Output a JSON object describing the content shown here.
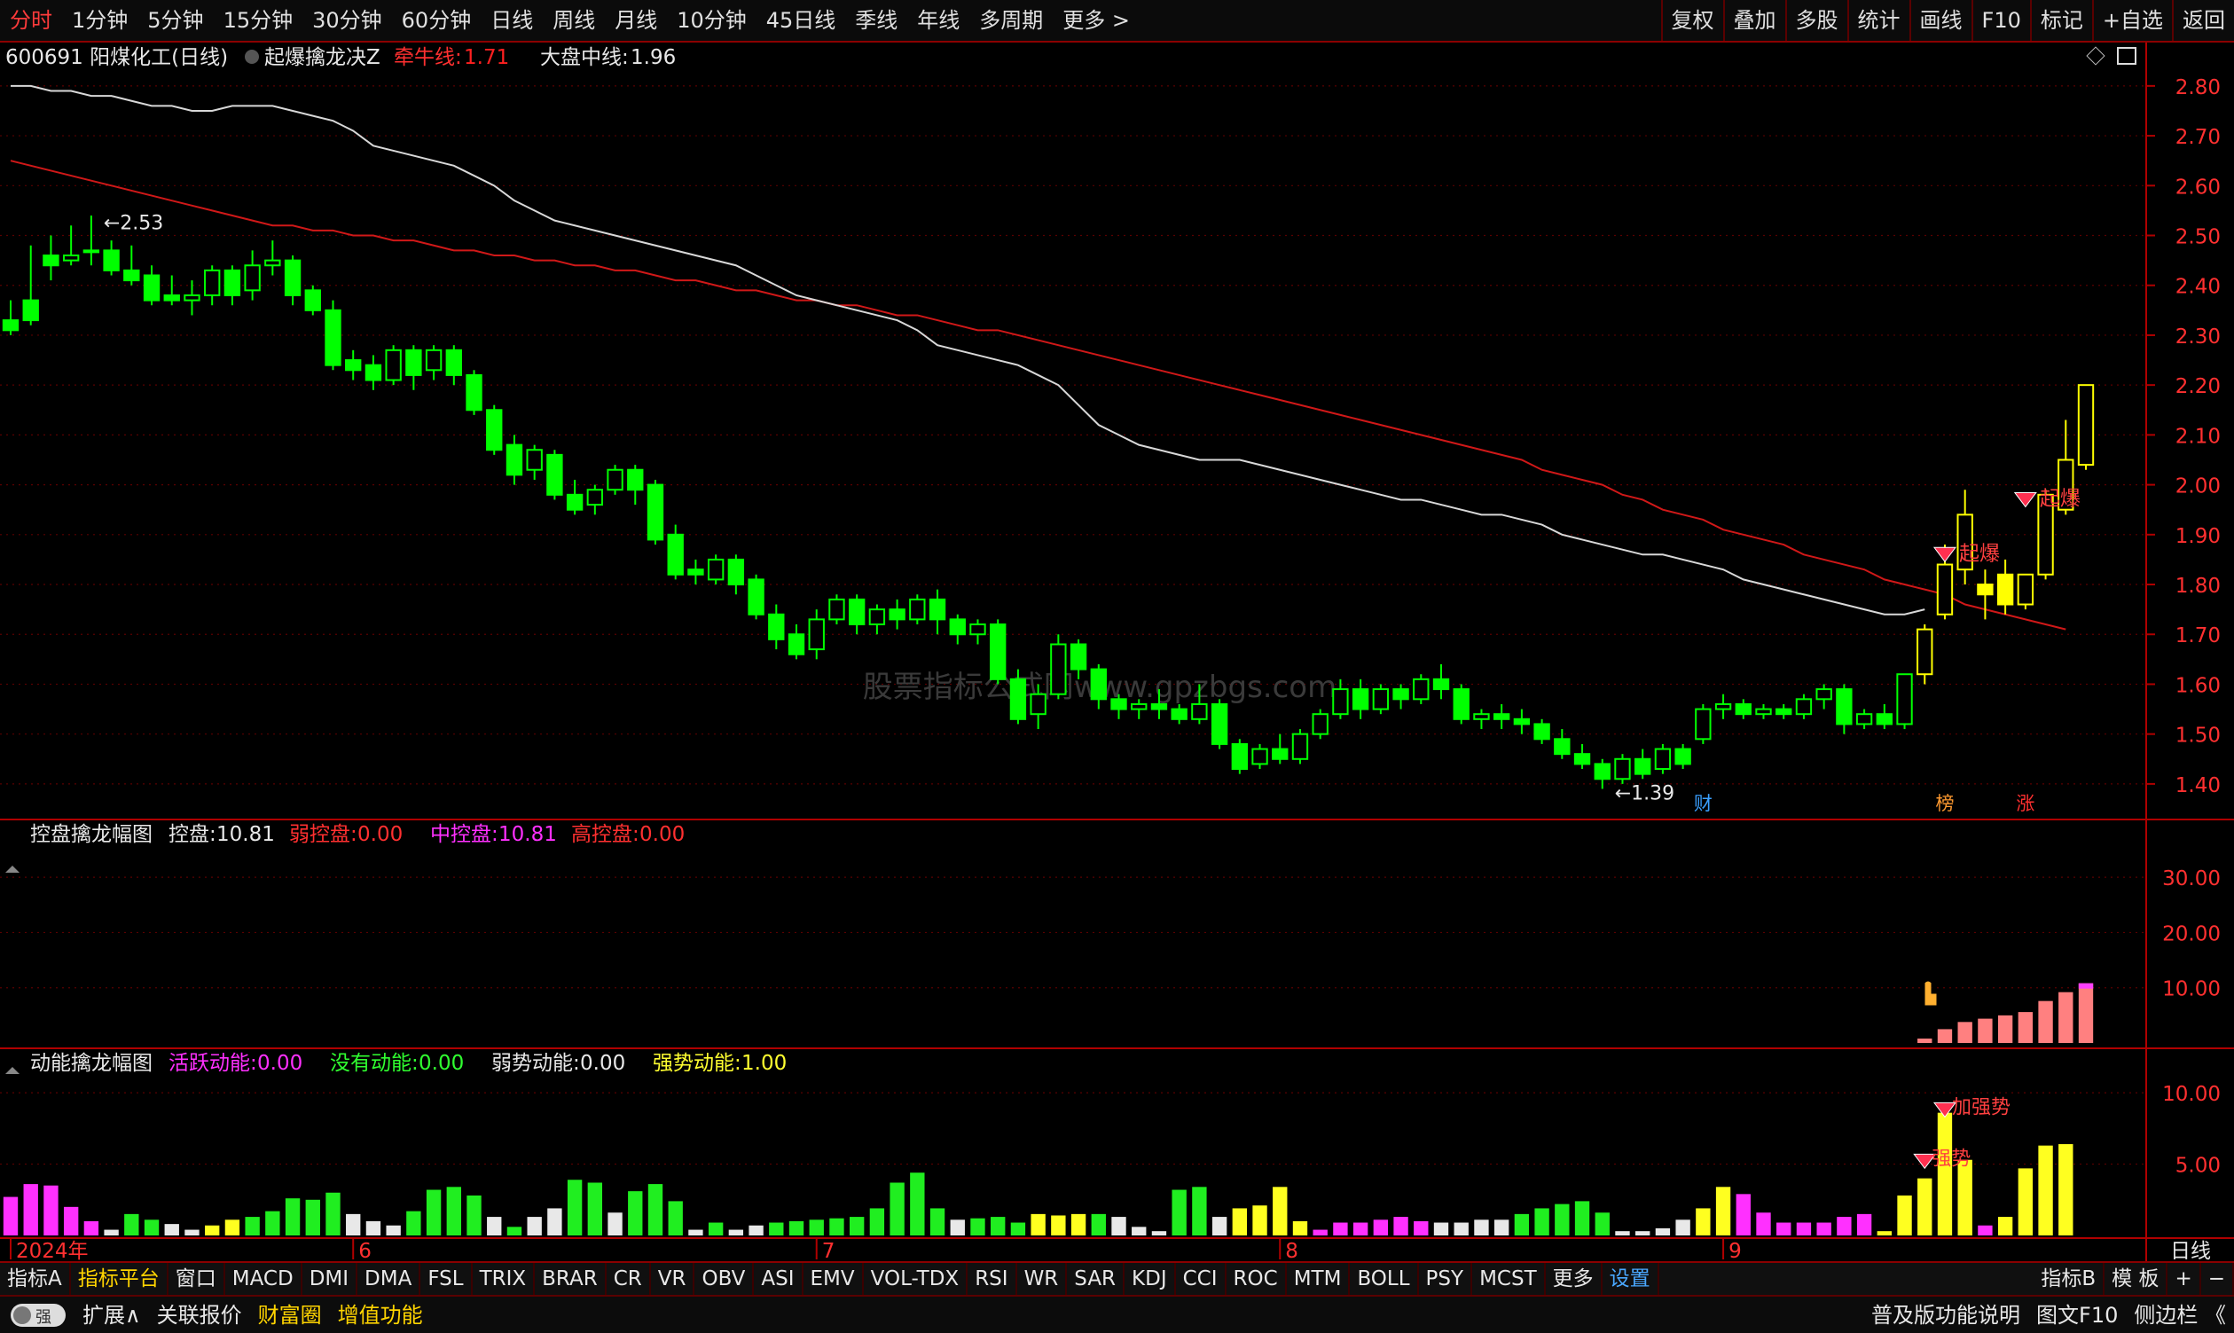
{
  "periods": [
    "分时",
    "1分钟",
    "5分钟",
    "15分钟",
    "30分钟",
    "60分钟",
    "日线",
    "周线",
    "月线",
    "10分钟",
    "45日线",
    "季线",
    "年线",
    "多周期",
    "更多 >"
  ],
  "active_period": "分时",
  "toolbar_right": [
    "复权",
    "叠加",
    "多股",
    "统计",
    "画线",
    "F10",
    "标记",
    "+自选",
    "返回"
  ],
  "indicator_tabs": [
    "指标A",
    "指标平台",
    "窗口",
    "MACD",
    "DMI",
    "DMA",
    "FSL",
    "TRIX",
    "BRAR",
    "CR",
    "VR",
    "OBV",
    "ASI",
    "EMV",
    "VOL-TDX",
    "RSI",
    "WR",
    "SAR",
    "KDJ",
    "CCI",
    "ROC",
    "MTM",
    "BOLL",
    "PSY",
    "MCST",
    "更多",
    "设置"
  ],
  "indicator_right": [
    "指标B",
    "模 板",
    "+",
    "−"
  ],
  "bottom_left": [
    "扩展∧",
    "关联报价",
    "财富圈",
    "增值功能"
  ],
  "bottom_right": [
    "普及版功能说明",
    "图文F10",
    "侧边栏 《"
  ],
  "toggle_label": "强",
  "period_label": "日线",
  "watermark": "股票指标公式网www.gpzbgs.com",
  "colors": {
    "up": "#00ff00",
    "down": "#00ff00",
    "yellow": "#ffff00",
    "red": "#ff2020",
    "white": "#e8e8e8",
    "magenta": "#ff00ff"
  },
  "chart_data": [
    {
      "type": "candlestick",
      "title": "600691 阳煤化工(日线)",
      "indicator": "起爆擒龙决Z",
      "legend": [
        {
          "name": "牵牛线",
          "value": "1.71",
          "color": "#ff2020"
        },
        {
          "name": "大盘中线",
          "value": "1.96",
          "color": "#e8e8e8"
        }
      ],
      "ylim": [
        1.35,
        2.83
      ],
      "yticks": [
        "2.80",
        "2.70",
        "2.60",
        "2.50",
        "2.40",
        "2.30",
        "2.20",
        "2.10",
        "2.00",
        "1.90",
        "1.80",
        "1.70",
        "1.60",
        "1.50",
        "1.40"
      ],
      "high_label": "←2.53",
      "low_label": "←1.39",
      "x_month_labels": [
        {
          "label": "2024年",
          "i": 0
        },
        {
          "label": "6",
          "i": 17
        },
        {
          "label": "7",
          "i": 40
        },
        {
          "label": "8",
          "i": 63
        },
        {
          "label": "9",
          "i": 85
        }
      ],
      "event_markers": [
        {
          "label": "财",
          "i": 84,
          "color": "#3aa0ff"
        },
        {
          "label": "榜",
          "i": 96,
          "color": "#ff9a30"
        },
        {
          "label": "涨",
          "i": 100,
          "color": "#ff3030"
        }
      ],
      "signals": [
        {
          "label": "起爆",
          "i": 96,
          "price": 1.86
        },
        {
          "label": "起爆",
          "i": 100,
          "price": 1.97
        }
      ],
      "candles": [
        [
          2.33,
          2.37,
          2.31,
          2.3
        ],
        [
          2.37,
          2.48,
          2.33,
          2.32
        ],
        [
          2.46,
          2.5,
          2.44,
          2.41
        ],
        [
          2.45,
          2.52,
          2.46,
          2.44
        ],
        [
          2.47,
          2.54,
          2.47,
          2.44
        ],
        [
          2.47,
          2.49,
          2.43,
          2.42
        ],
        [
          2.43,
          2.48,
          2.41,
          2.4
        ],
        [
          2.42,
          2.44,
          2.37,
          2.36
        ],
        [
          2.38,
          2.42,
          2.37,
          2.36
        ],
        [
          2.37,
          2.41,
          2.38,
          2.34
        ],
        [
          2.38,
          2.44,
          2.43,
          2.36
        ],
        [
          2.43,
          2.44,
          2.38,
          2.36
        ],
        [
          2.39,
          2.47,
          2.44,
          2.37
        ],
        [
          2.44,
          2.49,
          2.45,
          2.42
        ],
        [
          2.45,
          2.46,
          2.38,
          2.36
        ],
        [
          2.39,
          2.4,
          2.35,
          2.34
        ],
        [
          2.35,
          2.37,
          2.24,
          2.23
        ],
        [
          2.25,
          2.27,
          2.23,
          2.21
        ],
        [
          2.24,
          2.26,
          2.21,
          2.19
        ],
        [
          2.21,
          2.28,
          2.27,
          2.2
        ],
        [
          2.27,
          2.28,
          2.22,
          2.19
        ],
        [
          2.23,
          2.28,
          2.27,
          2.21
        ],
        [
          2.27,
          2.28,
          2.22,
          2.2
        ],
        [
          2.22,
          2.23,
          2.15,
          2.14
        ],
        [
          2.15,
          2.16,
          2.07,
          2.06
        ],
        [
          2.08,
          2.1,
          2.02,
          2.0
        ],
        [
          2.03,
          2.08,
          2.07,
          2.01
        ],
        [
          2.06,
          2.07,
          1.98,
          1.97
        ],
        [
          1.98,
          2.01,
          1.95,
          1.94
        ],
        [
          1.96,
          2.0,
          1.99,
          1.94
        ],
        [
          1.99,
          2.04,
          2.03,
          1.98
        ],
        [
          2.03,
          2.04,
          1.99,
          1.96
        ],
        [
          2.0,
          2.01,
          1.89,
          1.88
        ],
        [
          1.9,
          1.92,
          1.82,
          1.81
        ],
        [
          1.83,
          1.85,
          1.82,
          1.8
        ],
        [
          1.81,
          1.86,
          1.85,
          1.8
        ],
        [
          1.85,
          1.86,
          1.8,
          1.78
        ],
        [
          1.81,
          1.82,
          1.74,
          1.73
        ],
        [
          1.74,
          1.76,
          1.69,
          1.67
        ],
        [
          1.7,
          1.72,
          1.66,
          1.65
        ],
        [
          1.67,
          1.75,
          1.73,
          1.65
        ],
        [
          1.73,
          1.78,
          1.77,
          1.72
        ],
        [
          1.77,
          1.78,
          1.72,
          1.7
        ],
        [
          1.72,
          1.76,
          1.75,
          1.7
        ],
        [
          1.75,
          1.77,
          1.73,
          1.71
        ],
        [
          1.73,
          1.78,
          1.77,
          1.72
        ],
        [
          1.77,
          1.79,
          1.73,
          1.7
        ],
        [
          1.73,
          1.74,
          1.7,
          1.68
        ],
        [
          1.7,
          1.73,
          1.72,
          1.68
        ],
        [
          1.72,
          1.73,
          1.61,
          1.6
        ],
        [
          1.61,
          1.63,
          1.53,
          1.52
        ],
        [
          1.54,
          1.6,
          1.58,
          1.51
        ],
        [
          1.58,
          1.7,
          1.68,
          1.57
        ],
        [
          1.68,
          1.69,
          1.63,
          1.61
        ],
        [
          1.63,
          1.64,
          1.57,
          1.55
        ],
        [
          1.57,
          1.58,
          1.55,
          1.53
        ],
        [
          1.55,
          1.57,
          1.56,
          1.53
        ],
        [
          1.56,
          1.59,
          1.55,
          1.53
        ],
        [
          1.55,
          1.56,
          1.53,
          1.52
        ],
        [
          1.53,
          1.6,
          1.56,
          1.52
        ],
        [
          1.56,
          1.57,
          1.48,
          1.47
        ],
        [
          1.48,
          1.49,
          1.43,
          1.42
        ],
        [
          1.44,
          1.48,
          1.47,
          1.43
        ],
        [
          1.47,
          1.5,
          1.45,
          1.44
        ],
        [
          1.45,
          1.51,
          1.5,
          1.44
        ],
        [
          1.5,
          1.55,
          1.54,
          1.49
        ],
        [
          1.54,
          1.61,
          1.59,
          1.53
        ],
        [
          1.59,
          1.61,
          1.55,
          1.53
        ],
        [
          1.55,
          1.6,
          1.59,
          1.54
        ],
        [
          1.59,
          1.6,
          1.57,
          1.55
        ],
        [
          1.57,
          1.62,
          1.61,
          1.56
        ],
        [
          1.61,
          1.64,
          1.59,
          1.57
        ],
        [
          1.59,
          1.6,
          1.53,
          1.52
        ],
        [
          1.53,
          1.55,
          1.54,
          1.51
        ],
        [
          1.54,
          1.56,
          1.53,
          1.51
        ],
        [
          1.53,
          1.55,
          1.52,
          1.5
        ],
        [
          1.52,
          1.53,
          1.49,
          1.48
        ],
        [
          1.49,
          1.51,
          1.46,
          1.45
        ],
        [
          1.46,
          1.48,
          1.44,
          1.43
        ],
        [
          1.44,
          1.45,
          1.41,
          1.39
        ],
        [
          1.41,
          1.46,
          1.45,
          1.4
        ],
        [
          1.45,
          1.47,
          1.42,
          1.41
        ],
        [
          1.43,
          1.48,
          1.47,
          1.42
        ],
        [
          1.47,
          1.48,
          1.44,
          1.43
        ],
        [
          1.49,
          1.56,
          1.55,
          1.48
        ],
        [
          1.55,
          1.58,
          1.56,
          1.53
        ],
        [
          1.56,
          1.57,
          1.54,
          1.53
        ],
        [
          1.54,
          1.56,
          1.55,
          1.53
        ],
        [
          1.55,
          1.56,
          1.54,
          1.53
        ],
        [
          1.54,
          1.58,
          1.57,
          1.53
        ],
        [
          1.57,
          1.6,
          1.59,
          1.55
        ],
        [
          1.59,
          1.6,
          1.52,
          1.5
        ],
        [
          1.52,
          1.55,
          1.54,
          1.51
        ],
        [
          1.54,
          1.56,
          1.52,
          1.51
        ],
        [
          1.52,
          1.62,
          1.62,
          1.51
        ],
        [
          1.62,
          1.72,
          1.71,
          1.6
        ],
        [
          1.74,
          1.88,
          1.84,
          1.73
        ],
        [
          1.83,
          1.99,
          1.94,
          1.8
        ],
        [
          1.8,
          1.83,
          1.78,
          1.73
        ],
        [
          1.82,
          1.85,
          1.76,
          1.74
        ],
        [
          1.76,
          1.82,
          1.82,
          1.75
        ],
        [
          1.82,
          1.99,
          1.98,
          1.81
        ],
        [
          1.95,
          2.13,
          2.05,
          1.94
        ],
        [
          2.04,
          2.2,
          2.2,
          2.03
        ]
      ],
      "series_red": [
        2.65,
        2.64,
        2.63,
        2.62,
        2.61,
        2.6,
        2.59,
        2.58,
        2.57,
        2.56,
        2.55,
        2.54,
        2.53,
        2.52,
        2.52,
        2.51,
        2.51,
        2.5,
        2.5,
        2.49,
        2.49,
        2.48,
        2.47,
        2.47,
        2.46,
        2.46,
        2.45,
        2.45,
        2.44,
        2.44,
        2.43,
        2.43,
        2.42,
        2.41,
        2.41,
        2.4,
        2.39,
        2.39,
        2.38,
        2.37,
        2.37,
        2.36,
        2.36,
        2.35,
        2.34,
        2.34,
        2.33,
        2.32,
        2.31,
        2.31,
        2.3,
        2.29,
        2.28,
        2.27,
        2.26,
        2.25,
        2.24,
        2.23,
        2.22,
        2.21,
        2.2,
        2.19,
        2.18,
        2.17,
        2.16,
        2.15,
        2.14,
        2.13,
        2.12,
        2.11,
        2.1,
        2.09,
        2.08,
        2.07,
        2.06,
        2.05,
        2.03,
        2.02,
        2.01,
        2.0,
        1.98,
        1.97,
        1.95,
        1.94,
        1.93,
        1.91,
        1.9,
        1.89,
        1.88,
        1.86,
        1.85,
        1.84,
        1.83,
        1.81,
        1.8,
        1.79,
        1.78,
        1.76,
        1.75,
        1.74,
        1.73,
        1.72,
        1.71
      ],
      "series_white": [
        2.8,
        2.8,
        2.79,
        2.79,
        2.78,
        2.78,
        2.77,
        2.76,
        2.76,
        2.75,
        2.75,
        2.76,
        2.76,
        2.76,
        2.75,
        2.74,
        2.73,
        2.71,
        2.68,
        2.67,
        2.66,
        2.65,
        2.64,
        2.62,
        2.6,
        2.57,
        2.55,
        2.53,
        2.52,
        2.51,
        2.5,
        2.49,
        2.48,
        2.47,
        2.46,
        2.45,
        2.44,
        2.42,
        2.4,
        2.38,
        2.37,
        2.36,
        2.35,
        2.34,
        2.33,
        2.31,
        2.28,
        2.27,
        2.26,
        2.25,
        2.24,
        2.22,
        2.2,
        2.16,
        2.12,
        2.1,
        2.08,
        2.07,
        2.06,
        2.05,
        2.05,
        2.05,
        2.04,
        2.03,
        2.02,
        2.01,
        2.0,
        1.99,
        1.98,
        1.97,
        1.97,
        1.96,
        1.95,
        1.94,
        1.94,
        1.93,
        1.92,
        1.9,
        1.89,
        1.88,
        1.87,
        1.86,
        1.86,
        1.85,
        1.84,
        1.83,
        1.81,
        1.8,
        1.79,
        1.78,
        1.77,
        1.76,
        1.75,
        1.74,
        1.74,
        1.75
      ]
    },
    {
      "type": "bar",
      "title": "控盘擒龙幅图",
      "legend": [
        {
          "name": "控盘",
          "value": "10.81",
          "color": "#e8e8e8"
        },
        {
          "name": "弱控盘",
          "value": "0.00",
          "color": "#ff3030"
        },
        {
          "name": "中控盘",
          "value": "10.81",
          "color": "#ff30ff"
        },
        {
          "name": "高控盘",
          "value": "0.00",
          "color": "#ff3030"
        }
      ],
      "ylim": [
        0,
        35
      ],
      "yticks": [
        "30.00",
        "20.00",
        "10.00"
      ],
      "bars": [
        {
          "i": 95,
          "v": 0.8
        },
        {
          "i": 96,
          "v": 2.5
        },
        {
          "i": 97,
          "v": 3.8
        },
        {
          "i": 98,
          "v": 4.4
        },
        {
          "i": 99,
          "v": 5.0
        },
        {
          "i": 100,
          "v": 5.6
        },
        {
          "i": 101,
          "v": 7.6
        },
        {
          "i": 102,
          "v": 9.2
        },
        {
          "i": 103,
          "v": 10.81
        }
      ]
    },
    {
      "type": "bar",
      "title": "动能擒龙幅图",
      "legend": [
        {
          "name": "活跃动能",
          "value": "0.00",
          "color": "#ff30ff"
        },
        {
          "name": "没有动能",
          "value": "0.00",
          "color": "#30ff30"
        },
        {
          "name": "弱势动能",
          "value": "0.00",
          "color": "#e8e8e8"
        },
        {
          "name": "强势动能",
          "value": "1.00",
          "color": "#ffff30"
        }
      ],
      "ylim": [
        0,
        11.5
      ],
      "yticks": [
        "10.00",
        "5.00"
      ],
      "labels": [
        {
          "text": "加强势",
          "i": 96,
          "v": 8.8
        },
        {
          "text": "强势",
          "i": 95,
          "v": 5.2
        }
      ],
      "values": [
        2.7,
        3.6,
        3.5,
        2.0,
        1.0,
        0.4,
        1.5,
        1.1,
        0.8,
        0.4,
        0.7,
        1.1,
        1.3,
        1.7,
        2.6,
        2.5,
        3.0,
        1.5,
        1.0,
        0.7,
        1.7,
        3.2,
        3.4,
        2.8,
        1.3,
        0.6,
        1.3,
        1.9,
        3.9,
        3.7,
        1.6,
        3.1,
        3.6,
        2.4,
        0.4,
        0.9,
        0.4,
        0.7,
        0.9,
        1.0,
        1.1,
        1.2,
        1.3,
        1.9,
        3.7,
        4.4,
        1.9,
        1.1,
        1.2,
        1.3,
        0.9,
        1.5,
        1.4,
        1.5,
        1.5,
        1.3,
        0.6,
        0.3,
        3.2,
        3.4,
        1.3,
        1.9,
        2.1,
        3.4,
        1.0,
        0.4,
        0.9,
        0.9,
        1.1,
        1.3,
        1.0,
        0.9,
        0.9,
        1.1,
        1.1,
        1.5,
        1.9,
        2.2,
        2.4,
        1.6,
        0.3,
        0.3,
        0.5,
        1.1,
        1.9,
        3.4,
        2.9,
        1.6,
        0.9,
        0.9,
        0.9,
        1.3,
        1.5,
        0.3,
        2.8,
        4.0,
        8.6,
        5.3,
        0.7,
        1.3,
        4.7,
        6.3,
        6.4
      ],
      "colors": [
        "m",
        "m",
        "m",
        "m",
        "m",
        "w",
        "g",
        "g",
        "w",
        "w",
        "y",
        "y",
        "g",
        "g",
        "g",
        "g",
        "g",
        "w",
        "w",
        "w",
        "g",
        "g",
        "g",
        "g",
        "w",
        "g",
        "w",
        "w",
        "g",
        "g",
        "w",
        "g",
        "g",
        "g",
        "w",
        "g",
        "w",
        "w",
        "g",
        "g",
        "g",
        "g",
        "g",
        "g",
        "g",
        "g",
        "g",
        "w",
        "g",
        "g",
        "g",
        "y",
        "y",
        "y",
        "g",
        "w",
        "w",
        "w",
        "g",
        "g",
        "w",
        "y",
        "y",
        "y",
        "y",
        "m",
        "m",
        "m",
        "m",
        "m",
        "m",
        "w",
        "w",
        "w",
        "w",
        "g",
        "g",
        "g",
        "g",
        "g",
        "w",
        "w",
        "w",
        "w",
        "y",
        "y",
        "m",
        "m",
        "m",
        "m",
        "m",
        "m",
        "m",
        "y",
        "y",
        "y",
        "y",
        "y",
        "m",
        "y",
        "y",
        "y",
        "y"
      ]
    }
  ]
}
